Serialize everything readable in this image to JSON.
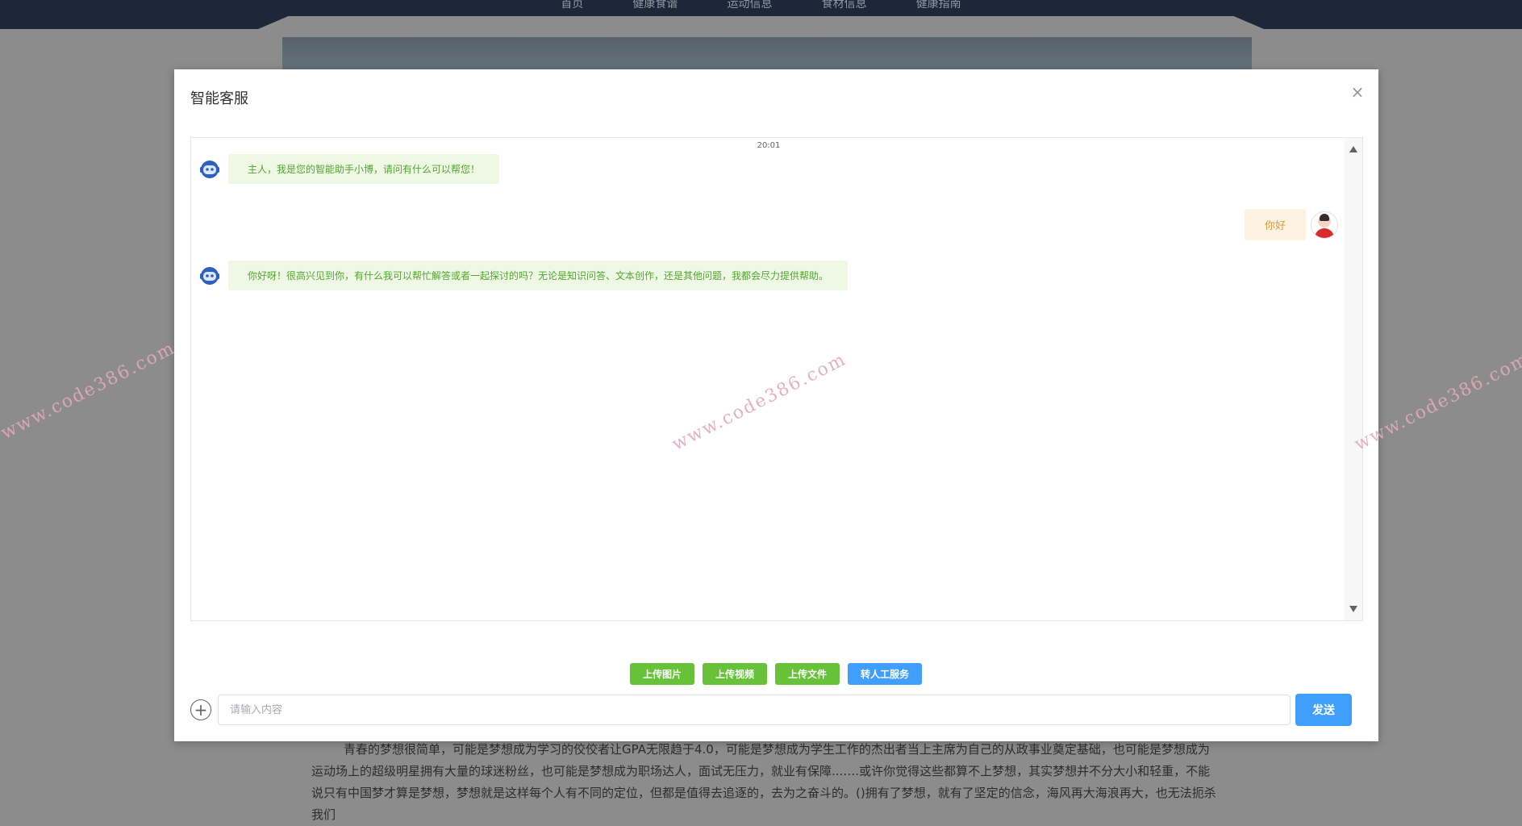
{
  "nav": {
    "items": [
      "首页",
      "健康食谱",
      "运动信息",
      "食材信息",
      "健康指南"
    ]
  },
  "article": {
    "text": "青春的梦想很简单，可能是梦想成为学习的佼佼者让GPA无限趋于4.0，可能是梦想成为学生工作的杰出者当上主席为自己的从政事业奠定基础，也可能是梦想成为运动场上的超级明星拥有大量的球迷粉丝，也可能是梦想成为职场达人，面试无压力，就业有保障...….或许你觉得这些都算不上梦想，其实梦想并不分大小和轻重，不能说只有中国梦才算是梦想，梦想就是这样每个人有不同的定位，但都是值得去追逐的，去为之奋斗的。()拥有了梦想，就有了坚定的信念，海风再大海浪再大，也无法扼杀我们"
  },
  "modal": {
    "title": "智能客服",
    "close_icon": "close-icon"
  },
  "chat": {
    "timestamp": "20:01",
    "messages": [
      {
        "from": "bot",
        "text": "主人，我是您的智能助手小博，请问有什么可以帮您！"
      },
      {
        "from": "user",
        "text": "你好"
      },
      {
        "from": "bot",
        "text": "你好呀！很高兴见到你，有什么我可以帮忙解答或者一起探讨的吗？无论是知识问答、文本创作，还是其他问题，我都会尽力提供帮助。"
      }
    ]
  },
  "watermark": "www.code386.com",
  "actions": {
    "upload_image": "上传图片",
    "upload_video": "上传视频",
    "upload_file": "上传文件",
    "human_service": "转人工服务"
  },
  "input": {
    "placeholder": "请输入内容",
    "send_label": "发送"
  },
  "colors": {
    "bot_bubble_bg": "#eef8e4",
    "bot_text": "#55a532",
    "user_bubble_bg": "#fdf3e3",
    "user_text": "#d49a3f",
    "primary": "#409eff",
    "success": "#67c23a"
  }
}
